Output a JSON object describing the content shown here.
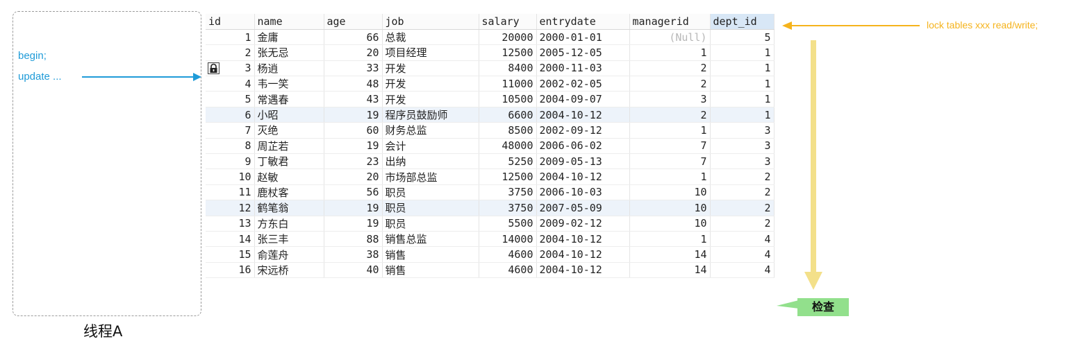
{
  "thread": {
    "lines": [
      "begin;",
      "update ..."
    ],
    "caption": "线程A"
  },
  "table": {
    "columns": [
      "id",
      "name",
      "age",
      "job",
      "salary",
      "entrydate",
      "managerid",
      "dept_id"
    ],
    "active_column": "dept_id",
    "locked_row_id": "3",
    "rows": [
      [
        "1",
        "金庸",
        "66",
        "总裁",
        "20000",
        "2000-01-01",
        "(Null)",
        "5"
      ],
      [
        "2",
        "张无忌",
        "20",
        "项目经理",
        "12500",
        "2005-12-05",
        "1",
        "1"
      ],
      [
        "3",
        "杨逍",
        "33",
        "开发",
        "8400",
        "2000-11-03",
        "2",
        "1"
      ],
      [
        "4",
        "韦一笑",
        "48",
        "开发",
        "11000",
        "2002-02-05",
        "2",
        "1"
      ],
      [
        "5",
        "常遇春",
        "43",
        "开发",
        "10500",
        "2004-09-07",
        "3",
        "1"
      ],
      [
        "6",
        "小昭",
        "19",
        "程序员鼓励师",
        "6600",
        "2004-10-12",
        "2",
        "1"
      ],
      [
        "7",
        "灭绝",
        "60",
        "财务总监",
        "8500",
        "2002-09-12",
        "1",
        "3"
      ],
      [
        "8",
        "周芷若",
        "19",
        "会计",
        "48000",
        "2006-06-02",
        "7",
        "3"
      ],
      [
        "9",
        "丁敏君",
        "23",
        "出纳",
        "5250",
        "2009-05-13",
        "7",
        "3"
      ],
      [
        "10",
        "赵敏",
        "20",
        "市场部总监",
        "12500",
        "2004-10-12",
        "1",
        "2"
      ],
      [
        "11",
        "鹿杖客",
        "56",
        "职员",
        "3750",
        "2006-10-03",
        "10",
        "2"
      ],
      [
        "12",
        "鹤笔翁",
        "19",
        "职员",
        "3750",
        "2007-05-09",
        "10",
        "2"
      ],
      [
        "13",
        "方东白",
        "19",
        "职员",
        "5500",
        "2009-02-12",
        "10",
        "2"
      ],
      [
        "14",
        "张三丰",
        "88",
        "销售总监",
        "14000",
        "2004-10-12",
        "1",
        "4"
      ],
      [
        "15",
        "俞莲舟",
        "38",
        "销售",
        "4600",
        "2004-10-12",
        "14",
        "4"
      ],
      [
        "16",
        "宋远桥",
        "40",
        "销售",
        "4600",
        "2004-10-12",
        "14",
        "4"
      ]
    ],
    "shaded_rows": [
      "6",
      "12"
    ]
  },
  "annotations": {
    "lock_note": "lock tables xxx read/write;",
    "check_label": "检查"
  },
  "colors": {
    "code_blue": "#1f9bd8",
    "lock_orange": "#f5b31c",
    "check_arrow": "#f3e08a",
    "check_green": "#92e08c"
  },
  "icons": {
    "row_lock": "padlock-icon"
  }
}
